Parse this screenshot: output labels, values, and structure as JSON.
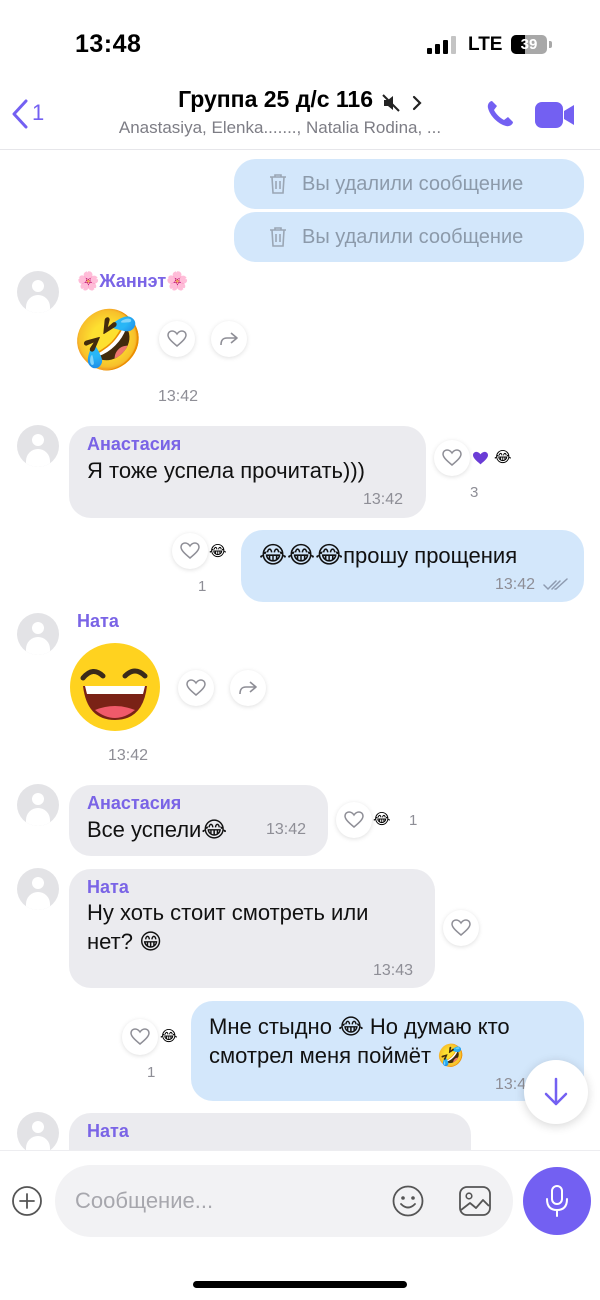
{
  "status": {
    "time": "13:48",
    "network": "LTE",
    "battery": "39",
    "battery_level": 0.39
  },
  "header": {
    "back_count": "1",
    "title": "Группа 25 д/с 116",
    "subtitle": "Anastasiya, Elenka......., Natalia Rodina, ...",
    "icons": [
      "back-chevron-icon",
      "mute-icon",
      "chevron-right-icon",
      "phone-icon",
      "video-camera-icon"
    ]
  },
  "messages": {
    "deleted_1": "Вы удалили сообщение",
    "deleted_2": "Вы удалили сообщение",
    "m1": {
      "sender": "🌸Жаннэт🌸",
      "sticker": "🤣",
      "time": "13:42"
    },
    "m2": {
      "sender": "Анастасия",
      "text": "Я тоже успела прочитать)))",
      "time": "13:42",
      "reactions": "😂",
      "reaction_count": "3"
    },
    "m3": {
      "text": "прошу прощения",
      "emoji_prefix": "😂😂😂",
      "time": "13:42",
      "reactions": "😂",
      "reaction_count": "1"
    },
    "m4": {
      "sender": "Ната",
      "time": "13:42"
    },
    "m5": {
      "sender": "Анастасия",
      "text": "Все успели",
      "emoji": "😂",
      "time": "13:42",
      "reactions": "😂",
      "reaction_count": "1"
    },
    "m6": {
      "sender": "Ната",
      "text_1": "Ну хоть стоит смотреть или",
      "text_2": "нет?",
      "emoji": "😁",
      "time": "13:43"
    },
    "m7": {
      "text_1": "Мне стыдно",
      "emoji_1": "😂",
      "text_1b": "Но думаю кто",
      "text_2": "смотрел меня поймёт",
      "emoji_2": "🤣",
      "time": "13:4",
      "reactions": "😂",
      "reaction_count": "1"
    },
    "m8": {
      "sender": "Ната"
    }
  },
  "composer": {
    "placeholder": "Сообщение...",
    "icons": [
      "plus-icon",
      "sticker-icon",
      "gallery-icon",
      "microphone-icon"
    ]
  },
  "colors": {
    "accent": "#7360f2",
    "outgoing_bubble": "#d3e7fb",
    "incoming_bubble": "#ebebef",
    "sender_name": "#7a64e6"
  }
}
